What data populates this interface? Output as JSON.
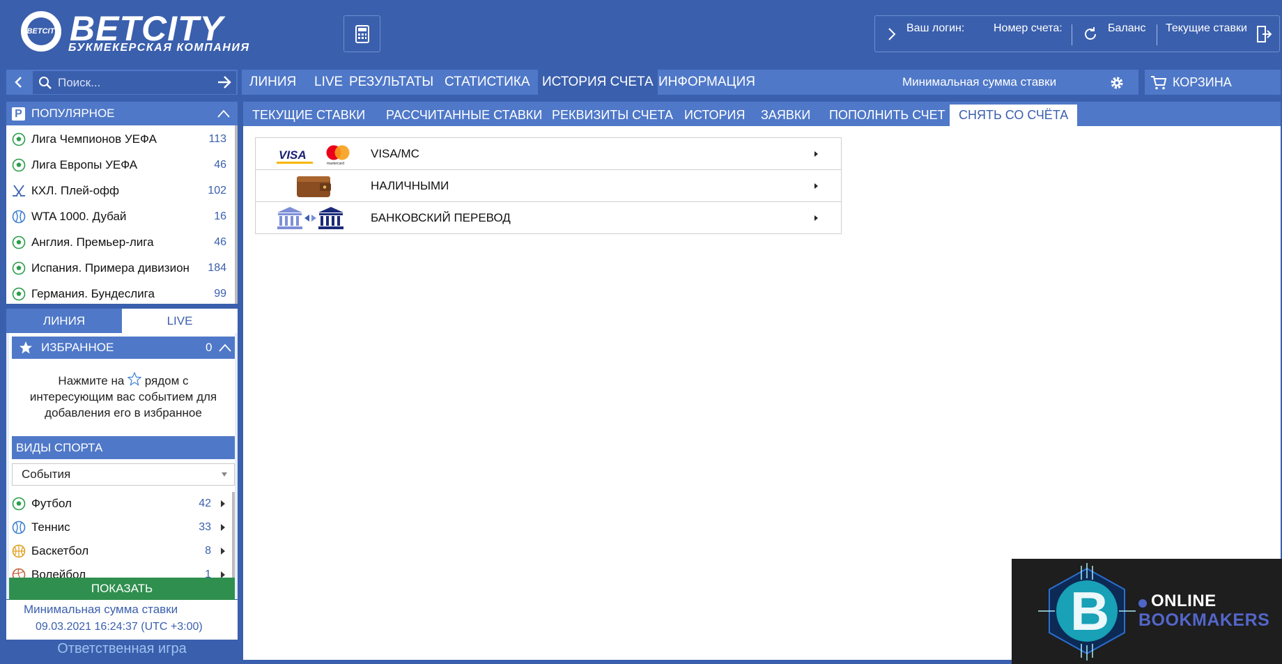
{
  "brand": {
    "name": "BETCITY",
    "emblem_text": "BETCITY",
    "subtitle": "БУКМЕКЕРСКАЯ КОМПАНИЯ"
  },
  "account": {
    "login_label": "Ваш логин:",
    "account_number_label": "Номер счета:",
    "balance_label": "Баланс",
    "current_bets_label": "Текущие ставки"
  },
  "search": {
    "placeholder": "Поиск..."
  },
  "main_nav": {
    "items": [
      "ЛИНИЯ",
      "LIVE",
      "РЕЗУЛЬТАТЫ",
      "СТАТИСТИКА",
      "ИСТОРИЯ СЧЕТА",
      "ИНФОРМАЦИЯ"
    ],
    "active": "ИСТОРИЯ СЧЕТА",
    "min_stake_label": "Минимальная сумма ставки"
  },
  "cart": {
    "label": "КОРЗИНА"
  },
  "popular": {
    "title": "ПОПУЛЯРНОЕ",
    "badge": "P",
    "items": [
      {
        "label": "Лига Чемпионов УЕФА",
        "count": "113",
        "icon": "football-icon"
      },
      {
        "label": "Лига Европы УЕФА",
        "count": "46",
        "icon": "football-icon"
      },
      {
        "label": "КХЛ. Плей-офф",
        "count": "102",
        "icon": "hockey-icon"
      },
      {
        "label": "WTA 1000. Дубай",
        "count": "16",
        "icon": "tennis-icon"
      },
      {
        "label": "Англия. Премьер-лига",
        "count": "46",
        "icon": "football-icon"
      },
      {
        "label": "Испания. Примера дивизион",
        "count": "184",
        "icon": "football-icon"
      },
      {
        "label": "Германия. Бундеслига",
        "count": "99",
        "icon": "football-icon"
      }
    ]
  },
  "line_live_tabs": {
    "line": "ЛИНИЯ",
    "live": "LIVE",
    "active": "ЛИНИЯ"
  },
  "favorites": {
    "title": "ИЗБРАННОЕ",
    "count": "0",
    "hint_before": "Нажмите на",
    "hint_after": "рядом с интересующим вас событием для добавления его в избранное"
  },
  "sports": {
    "title": "ВИДЫ СПОРТА",
    "filter_value": "События",
    "items": [
      {
        "label": "Футбол",
        "count": "42",
        "icon": "football-icon"
      },
      {
        "label": "Теннис",
        "count": "33",
        "icon": "tennis-icon"
      },
      {
        "label": "Баскетбол",
        "count": "8",
        "icon": "basketball-icon"
      },
      {
        "label": "Волейбол",
        "count": "1",
        "icon": "volleyball-icon"
      }
    ],
    "show_button": "ПОКАЗАТЬ"
  },
  "footer": {
    "min_stake_link": "Минимальная сумма ставки",
    "datetime": "09.03.2021 16:24:37 (UTC +3:00)",
    "responsible_gaming": "Ответственная игра"
  },
  "sub_tabs": {
    "items": [
      "ТЕКУЩИЕ СТАВКИ",
      "РАССЧИТАННЫЕ СТАВКИ",
      "РЕКВИЗИТЫ СЧЕТА",
      "ИСТОРИЯ",
      "ЗАЯВКИ",
      "ПОПОЛНИТЬ СЧЕТ",
      "СНЯТЬ СО СЧЁТА"
    ],
    "active": "СНЯТЬ СО СЧЁТА"
  },
  "withdraw_methods": [
    {
      "label": "VISA/MC",
      "icon": "visa-mastercard-icon",
      "visa_text": "VISA",
      "mc_text": "mastercard"
    },
    {
      "label": "НАЛИЧНЫМИ",
      "icon": "wallet-icon"
    },
    {
      "label": "БАНКОВСКИЙ ПЕРЕВОД",
      "icon": "bank-transfer-icon"
    }
  ],
  "watermark": {
    "letter": "B",
    "line1": "ONLINE",
    "line2": "BOOKMAKERS"
  },
  "colors": {
    "brand_blue": "#3a5fad",
    "nav_blue": "#4f78c8",
    "show_green": "#2f8f4e",
    "link_blue": "#3a5fad"
  }
}
